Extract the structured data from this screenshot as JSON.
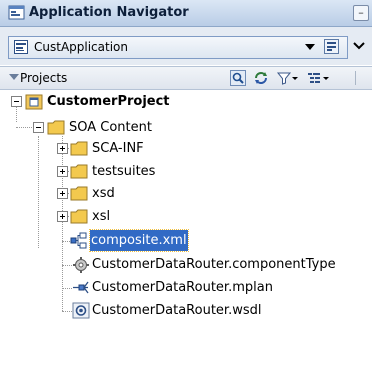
{
  "titlebar": {
    "title": "Application Navigator"
  },
  "application": {
    "name": "CustApplication"
  },
  "projects": {
    "label": "Projects"
  },
  "tree": {
    "root": "CustomerProject",
    "soa_content": "SOA Content",
    "folders": [
      "SCA-INF",
      "testsuites",
      "xsd",
      "xsl"
    ],
    "files": [
      "composite.xml",
      "CustomerDataRouter.componentType",
      "CustomerDataRouter.mplan",
      "CustomerDataRouter.wsdl"
    ],
    "selected": "composite.xml"
  },
  "colors": {
    "selection": "#316ac5",
    "folder": "#f3c94e"
  }
}
